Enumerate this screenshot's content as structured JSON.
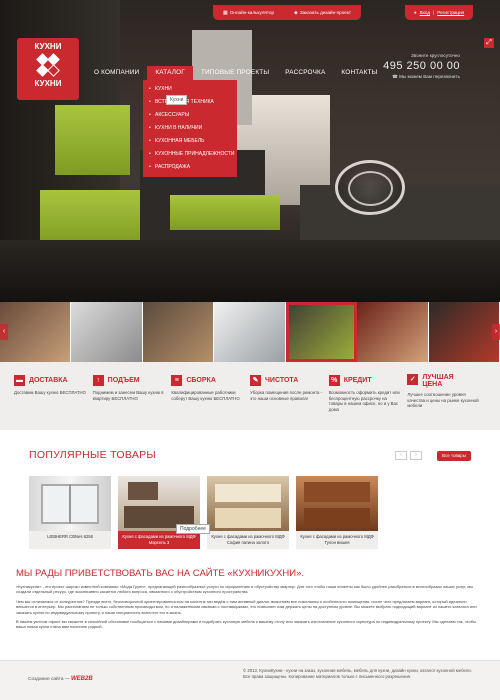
{
  "topbar": {
    "calc": "Онлайн-калькулятор",
    "order": "Заказать дизайн-проект"
  },
  "auth": {
    "login": "Вход",
    "register": "Регистрация"
  },
  "logo": {
    "top": "КУХНИ",
    "bottom": "КУХНИ"
  },
  "nav": [
    "О КОМПАНИИ",
    "КАТАЛОГ",
    "ТИПОВЫЕ ПРОЕКТЫ",
    "РАССРОЧКА",
    "КОНТАКТЫ"
  ],
  "dropdown": {
    "items": [
      "КУХНИ",
      "ВСТРОЕННАЯ ТЕХНИКА",
      "АКСЕССУАРЫ",
      "КУХНИ В НАЛИЧИИ",
      "КУХОННАЯ МЕБЕЛЬ",
      "КУХОННЫЕ ПРИНАДЛЕЖНОСТИ",
      "РАСПРОДАЖА"
    ],
    "tooltip": "Кухни"
  },
  "contact": {
    "label": "Звоните круглосуточно",
    "phone": "495 250 00 00",
    "callback": "Мы можем Вам перезвонить"
  },
  "features": [
    {
      "icon": "truck-icon",
      "glyph": "▬",
      "title": "ДОСТАВКА",
      "text": "Доставим Вашу кухню БЕСПЛАТНО"
    },
    {
      "icon": "arrow-up-icon",
      "glyph": "↑",
      "title": "ПОДЪЕМ",
      "text": "Поднимем и занесем Вашу кухню в квартиру БЕСПЛАТНО"
    },
    {
      "icon": "layers-icon",
      "glyph": "≡",
      "title": "СБОРКА",
      "text": "Квалифицированные работники соберут Вашу кухню БЕСПЛАТНО"
    },
    {
      "icon": "brush-icon",
      "glyph": "✎",
      "title": "ЧИСТОТА",
      "text": "Уборка помещения после ремонта - это наши основные правила!"
    },
    {
      "icon": "percent-icon",
      "glyph": "%",
      "title": "КРЕДИТ",
      "text": "Возможность оформить кредит или беспроцентную рассрочку на товары в нашем офисе, но и у Вас дома"
    },
    {
      "icon": "thumbs-up-icon",
      "glyph": "✓",
      "title": "ЛУЧШАЯ ЦЕНА",
      "text": "Лучшее соотношение уровня качества и цены на рынке кухонной мебели"
    }
  ],
  "popular": {
    "title": "ПОПУЛЯРНЫЕ ТОВАРЫ",
    "pager": [
      "‹",
      "›"
    ],
    "all": "Все товары",
    "products": [
      {
        "caption": "LIEBHERR CBNes 6256"
      },
      {
        "caption": "Кухня с фасадами из рамочного МДФ Марсель 3"
      },
      {
        "caption": "Кухня с фасадами из рамочного МДФ София патина золото"
      },
      {
        "caption": "Кухня с фасадами из рамочного МДФ Тулон вишня"
      }
    ],
    "tooltip": "Подробнее"
  },
  "welcome": {
    "title": "МЫ РАДЫ ПРИВЕТСТВОВАТЬ ВАС НА САЙТЕ «КУХНИКУХНИ».",
    "p1": "«Кухникухни» - это проект широко известной компании «Мода Групп», предлагающей разнообразные услуги по оформлению и обустройству квартир. Для того чтобы наши клиенты как было удобнее разобраться в многообразии наших услуг, мы создали отдельный ресурс, где эксклюзивно касается любого вопроса, связанного с обустройством кухонного пространства.",
    "p2": "Чем мы отличаемся от конкурентов? Прежде всего, безоговорочной ориентированностью на клиента: мы ведём с ним активный диалог, выясняем все пожелания и особенности помещения, после чего предлагаем вариант, который идеально впишется в интерьер. Мы располагаем не только собственным производством, но и налаженными связями с поставщиками, что позволяет нам держать цены на доступном уровне. Вы можете выбрать подходящий вариант из нашего каталога или заказать кухню по индивидуальному проекту, и наши специалисты воплотят его в жизнь.",
    "p3": "В нашем уютном офисе вы сможете в спокойной обстановке пообщаться с нашими дизайнерами и подобрать кухонную мебель к вашему столу или заказать изготовление кухонного гарнитура по индивидуальному проекту. Мы сделаем так, чтобы ваша новая кухня стала вам поистине родной."
  },
  "footer": {
    "made": "Создание сайта —",
    "brand": "WEB2B",
    "copy1": "© 2013, КухниКухни - кухни на заказ, кухонная мебель, мебель для кухни, дизайн кухни, каталог кухонной мебели.",
    "copy2": "Все права защищены. Копирование материалов только с письменного разрешения."
  }
}
